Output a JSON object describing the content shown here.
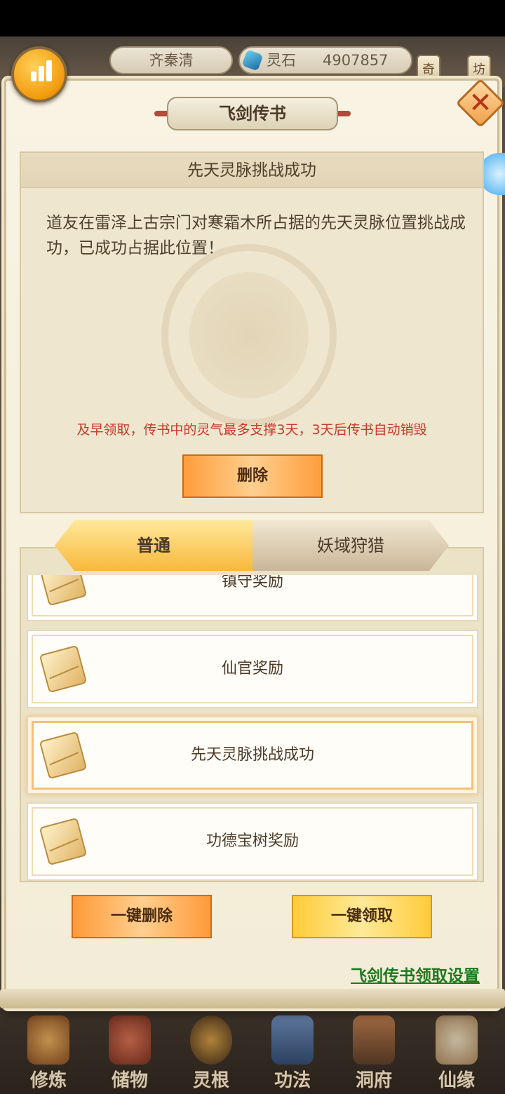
{
  "top_bar": {
    "player_name": "齐秦清",
    "spirit_stone_label": "灵石",
    "spirit_stone_value": "4907857",
    "side_tags": [
      "奇",
      "坊"
    ]
  },
  "panel": {
    "title": "飞剑传书",
    "message": {
      "title": "先天灵脉挑战成功",
      "body": "道友在雷泽上古宗门对寒霜木所占据的先天灵脉位置挑战成功，已成功占据此位置！",
      "expiry_note": "及早领取，传书中的灵气最多支撑3天，3天后传书自动销毁",
      "delete_label": "删除"
    },
    "tabs": [
      {
        "label": "普通",
        "active": true
      },
      {
        "label": "妖域狩猎",
        "active": false
      }
    ],
    "mail_items": [
      {
        "label": "镇守奖励",
        "selected": false
      },
      {
        "label": "仙官奖励",
        "selected": false
      },
      {
        "label": "先天灵脉挑战成功",
        "selected": true
      },
      {
        "label": "功德宝树奖励",
        "selected": false
      }
    ],
    "delete_all_label": "一键删除",
    "claim_all_label": "一键领取",
    "settings_link": "飞剑传书领取设置"
  },
  "bottom_nav": {
    "items": [
      {
        "label": "修炼",
        "icon": "cultivation-icon"
      },
      {
        "label": "储物",
        "icon": "storage-bag-icon"
      },
      {
        "label": "灵根",
        "icon": "spirit-root-icon"
      },
      {
        "label": "功法",
        "icon": "technique-book-icon"
      },
      {
        "label": "洞府",
        "icon": "cave-abode-icon"
      },
      {
        "label": "仙缘",
        "icon": "immortal-fate-icon"
      }
    ]
  },
  "colors": {
    "accent_orange": "#ff9d3d",
    "accent_gold": "#ffcc39",
    "warning_red": "#c53a2b",
    "link_green": "#1d7a1e"
  }
}
